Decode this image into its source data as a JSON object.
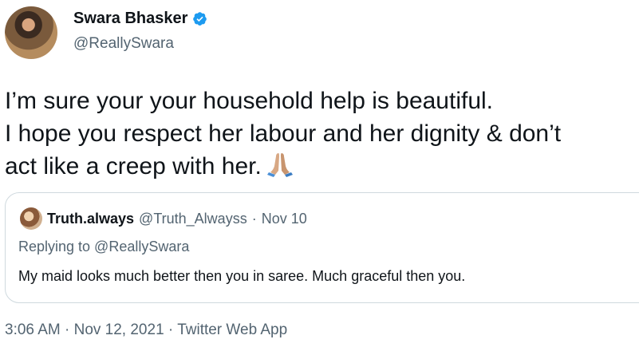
{
  "author": {
    "name": "Swara Bhasker",
    "handle": "@ReallySwara",
    "verified": true
  },
  "tweet": {
    "text": "I’m sure your your household help is beautiful.\nI hope you respect her labour and her dignity & don’t\nact like a creep with her.",
    "emoji": "folded-hands-icon"
  },
  "quoted_tweet": {
    "name": "Truth.always",
    "handle": "@Truth_Alwayss",
    "separator": "·",
    "date": "Nov 10",
    "replying_to": "Replying to @ReallySwara",
    "text": "My maid looks much better then you in saree. Much graceful then you."
  },
  "meta": {
    "time": "3:06 AM",
    "separator": "·",
    "date": "Nov 12, 2021",
    "source": "Twitter Web App"
  },
  "colors": {
    "verified_blue": "#1d9bf0",
    "secondary_text": "#536471",
    "border": "#cfd9de"
  }
}
